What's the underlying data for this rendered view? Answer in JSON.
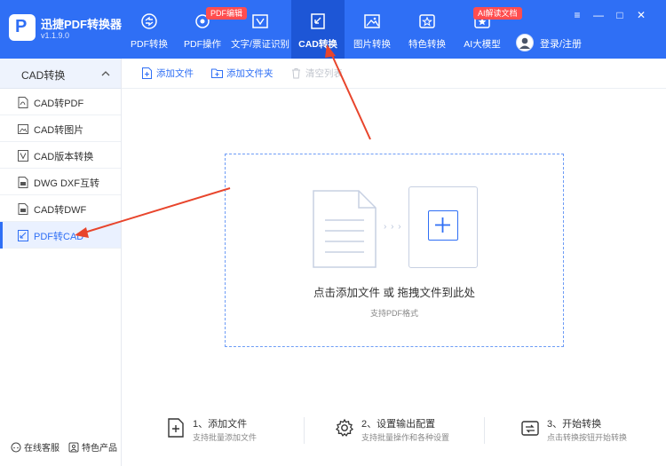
{
  "app": {
    "name": "迅捷PDF转换器",
    "version": "v1.1.9.0",
    "logo_letter": "P"
  },
  "nav": [
    {
      "label": "PDF转换",
      "icon": "pdf-convert-icon",
      "badge": ""
    },
    {
      "label": "PDF操作",
      "icon": "pdf-operate-icon",
      "badge": "PDF编辑"
    },
    {
      "label": "文字/票证识别",
      "icon": "text-recognition-icon",
      "badge": ""
    },
    {
      "label": "CAD转换",
      "icon": "cad-convert-icon",
      "badge": "",
      "active": true
    },
    {
      "label": "图片转换",
      "icon": "image-convert-icon",
      "badge": ""
    },
    {
      "label": "特色转换",
      "icon": "special-convert-icon",
      "badge": ""
    },
    {
      "label": "AI大模型",
      "icon": "ai-model-icon",
      "badge": "AI解读文档"
    }
  ],
  "login": {
    "label": "登录/注册"
  },
  "window_controls": {
    "menu": "≡",
    "minimize": "—",
    "maximize": "□",
    "close": "✕"
  },
  "sidebar": {
    "header": "CAD转换",
    "items": [
      {
        "label": "CAD转PDF",
        "icon": "pdf-file-icon"
      },
      {
        "label": "CAD转图片",
        "icon": "image-file-icon"
      },
      {
        "label": "CAD版本转换",
        "icon": "version-icon"
      },
      {
        "label": "DWG DXF互转",
        "icon": "dwg-file-icon"
      },
      {
        "label": "CAD转DWF",
        "icon": "dwf-file-icon"
      },
      {
        "label": "PDF转CAD",
        "icon": "cad-file-icon",
        "active": true
      }
    ],
    "footer": {
      "service": "在线客服",
      "products": "特色产品"
    }
  },
  "toolbar": {
    "add_file": "添加文件",
    "add_folder": "添加文件夹",
    "clear_list": "清空列表"
  },
  "dropzone": {
    "title": "点击添加文件 或 拖拽文件到此处",
    "subtitle": "支持PDF格式",
    "dots": "› › ›"
  },
  "steps": [
    {
      "title": "1、添加文件",
      "desc": "支持批量添加文件"
    },
    {
      "title": "2、设置输出配置",
      "desc": "支持批量操作和各种设置"
    },
    {
      "title": "3、开始转换",
      "desc": "点击转换按钮开始转换"
    }
  ],
  "colors": {
    "brand": "#2f6ff5",
    "brand_dark": "#1d56d6",
    "badge": "#ff4d4f",
    "annotation_arrow": "#e8452c"
  }
}
